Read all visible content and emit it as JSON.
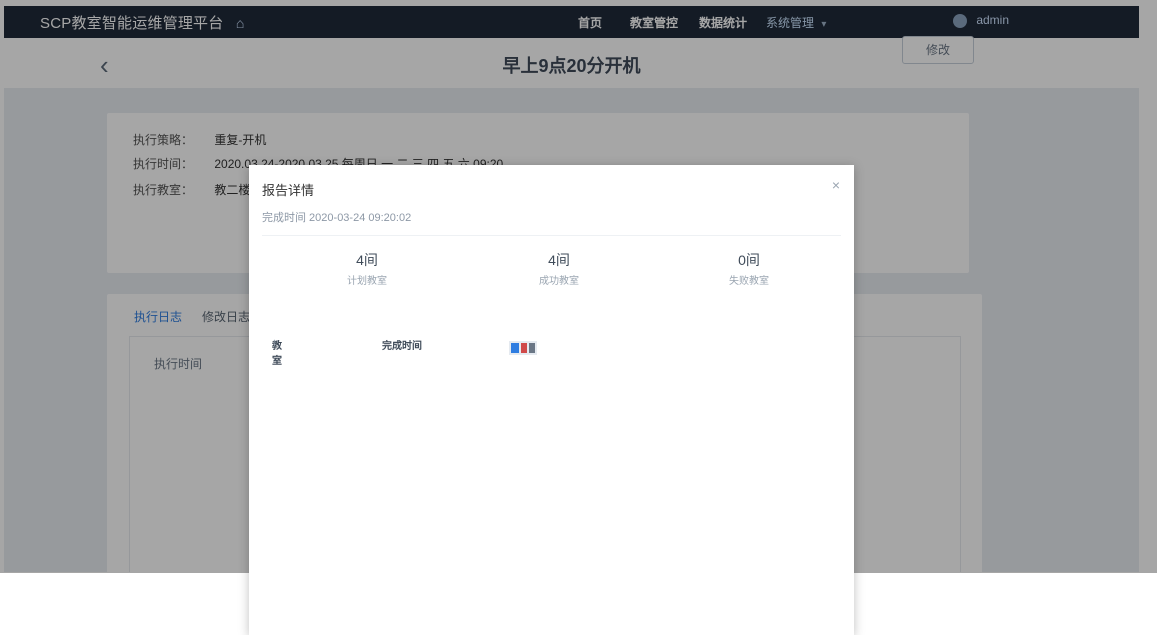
{
  "nav": {
    "brand": "SCP教室智能运维管理平台",
    "items": [
      {
        "label": "首页"
      },
      {
        "label": "教室管控"
      },
      {
        "label": "数据统计"
      },
      {
        "label": "系统管理"
      }
    ],
    "user": "admin"
  },
  "page": {
    "title": "早上9点20分开机",
    "edit_label": "修改"
  },
  "info": {
    "strategy_label": "执行策略：",
    "strategy_value": "重复-开机",
    "time_label": "执行时间：",
    "time_value": "2020.03.24-2020.03.25  每周日,一,二,三,四,五,六  09:20",
    "room_label": "执行教室：",
    "room_value": "教二楼"
  },
  "tabs": [
    {
      "label": "执行日志"
    },
    {
      "label": "修改日志"
    }
  ],
  "log_table": {
    "header_time": "执行时间"
  },
  "modal": {
    "title": "报告详情",
    "done_time": "完成时间 2020-03-24 09:20:02",
    "stats": [
      {
        "num": "4间",
        "label": "计划教室"
      },
      {
        "num": "4间",
        "label": "成功教室"
      },
      {
        "num": "0间",
        "label": "失败教室"
      }
    ],
    "list_headers": {
      "room": "教室",
      "done": "完成时间"
    }
  },
  "colors": {
    "nav_bg": "#1f2a3a",
    "page_bg": "#e9edf2"
  }
}
